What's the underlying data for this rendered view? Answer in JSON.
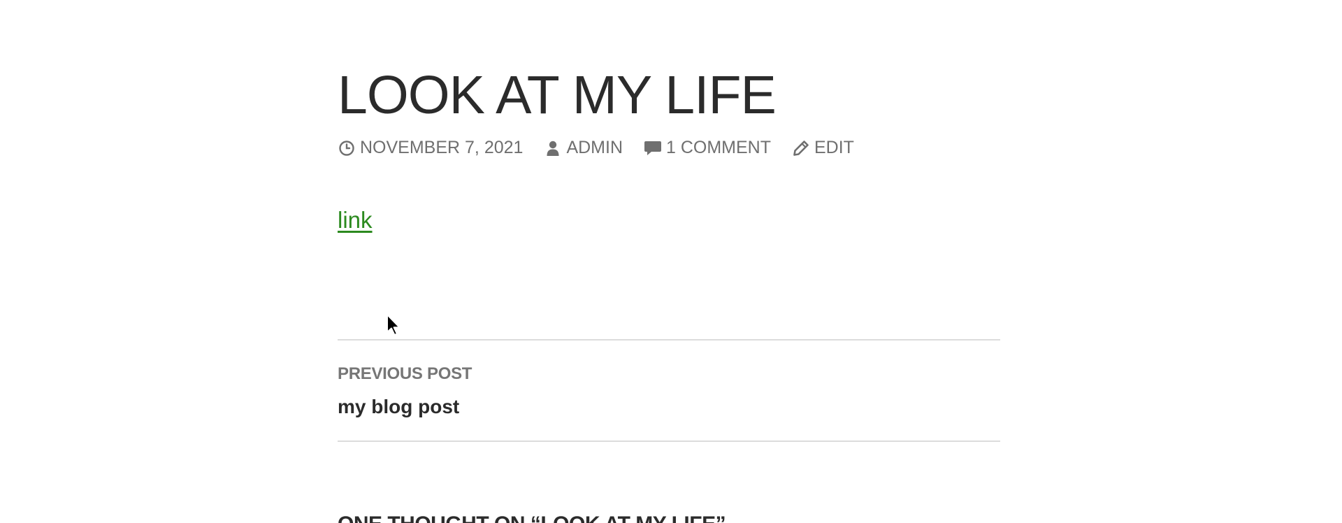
{
  "post": {
    "title": "LOOK AT MY LIFE",
    "link_text": "link"
  },
  "meta": {
    "date": "NOVEMBER 7, 2021",
    "author": "ADMIN",
    "comments": "1 COMMENT",
    "edit": "EDIT",
    "date_icon": "clock-icon",
    "author_icon": "user-icon",
    "comments_icon": "comment-icon",
    "edit_icon": "pencil-icon"
  },
  "navigation": {
    "label": "PREVIOUS POST",
    "title": "my blog post"
  },
  "comments": {
    "heading": "ONE THOUGHT ON “LOOK AT MY LIFE”"
  },
  "colors": {
    "link": "#2c8a1f",
    "meta": "#6f6f6f",
    "title": "#2b2b2b",
    "divider": "#dcdcdc"
  }
}
